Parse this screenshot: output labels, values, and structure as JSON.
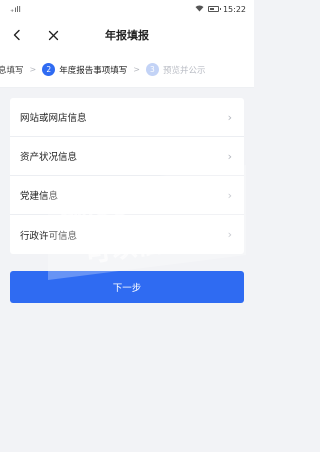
{
  "status_bar": {
    "signal": "₊ıll",
    "time": "15:22"
  },
  "nav": {
    "title": "年报填报"
  },
  "steps": [
    {
      "number": "",
      "label": "息填写",
      "state": "done"
    },
    {
      "number": "2",
      "label": "年度报告事项填写",
      "state": "active"
    },
    {
      "number": "3",
      "label": "预览并公示",
      "state": "pending"
    }
  ],
  "menu": [
    {
      "label": "网站或网店信息"
    },
    {
      "label": "资产状况信息"
    },
    {
      "label": "党建信息"
    },
    {
      "label": "行政许可信息"
    }
  ],
  "next_button": {
    "label": "下一步"
  },
  "watermark": {
    "line1": "额度多么",
    "line2": "可以信钱"
  },
  "colors": {
    "primary": "#2f6bf2",
    "pending_step": "#c3d3f6",
    "background": "#f2f3f6"
  }
}
